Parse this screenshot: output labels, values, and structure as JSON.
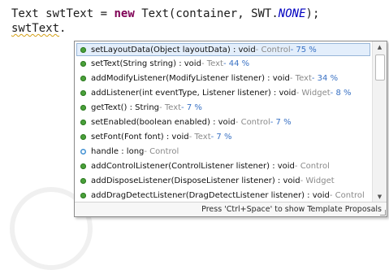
{
  "editor": {
    "line1": {
      "type1": "Text",
      "var": "swtText",
      "eq": "=",
      "keyword": "new",
      "ctor": "Text(container, SWT.",
      "constant": "NONE",
      "end": ");"
    },
    "line2": {
      "var": "swtText",
      "dot": "."
    }
  },
  "proposals": [
    {
      "icon": "public-method-icon",
      "signature": "setLayoutData(Object layoutData) : void",
      "owner": " - Control",
      "relevance": " - 75 %",
      "selected": true
    },
    {
      "icon": "public-method-icon",
      "signature": "setText(String string) : void",
      "owner": " - Text",
      "relevance": " - 44 %"
    },
    {
      "icon": "public-method-icon",
      "signature": "addModifyListener(ModifyListener listener) : void",
      "owner": " - Text",
      "relevance": " - 34 %"
    },
    {
      "icon": "public-method-icon",
      "signature": "addListener(int eventType, Listener listener) : void",
      "owner": " - Widget",
      "relevance": " - 8 %"
    },
    {
      "icon": "public-method-icon",
      "signature": "getText() : String",
      "owner": " - Text",
      "relevance": " - 7 %"
    },
    {
      "icon": "public-method-icon",
      "signature": "setEnabled(boolean enabled) : void",
      "owner": " - Control",
      "relevance": " - 7 %"
    },
    {
      "icon": "public-method-icon",
      "signature": "setFont(Font font) : void",
      "owner": " - Text",
      "relevance": " - 7 %"
    },
    {
      "icon": "public-field-icon",
      "signature": "handle : long",
      "owner": " - Control",
      "relevance": ""
    },
    {
      "icon": "public-method-icon",
      "signature": "addControlListener(ControlListener listener) : void",
      "owner": " - Control",
      "relevance": ""
    },
    {
      "icon": "public-method-icon",
      "signature": "addDisposeListener(DisposeListener listener) : void",
      "owner": " - Widget",
      "relevance": ""
    },
    {
      "icon": "public-method-icon",
      "signature": "addDragDetectListener(DragDetectListener listener) : void",
      "owner": " - Control",
      "relevance": ""
    }
  ],
  "footer": {
    "text": "Press 'Ctrl+Space' to show Template Proposals"
  },
  "colors": {
    "keyword": "#7f0055",
    "constant": "#0000c0",
    "relevance": "#3a72c4",
    "selection": "#e3eefb",
    "method_icon": "#4aa13a"
  }
}
